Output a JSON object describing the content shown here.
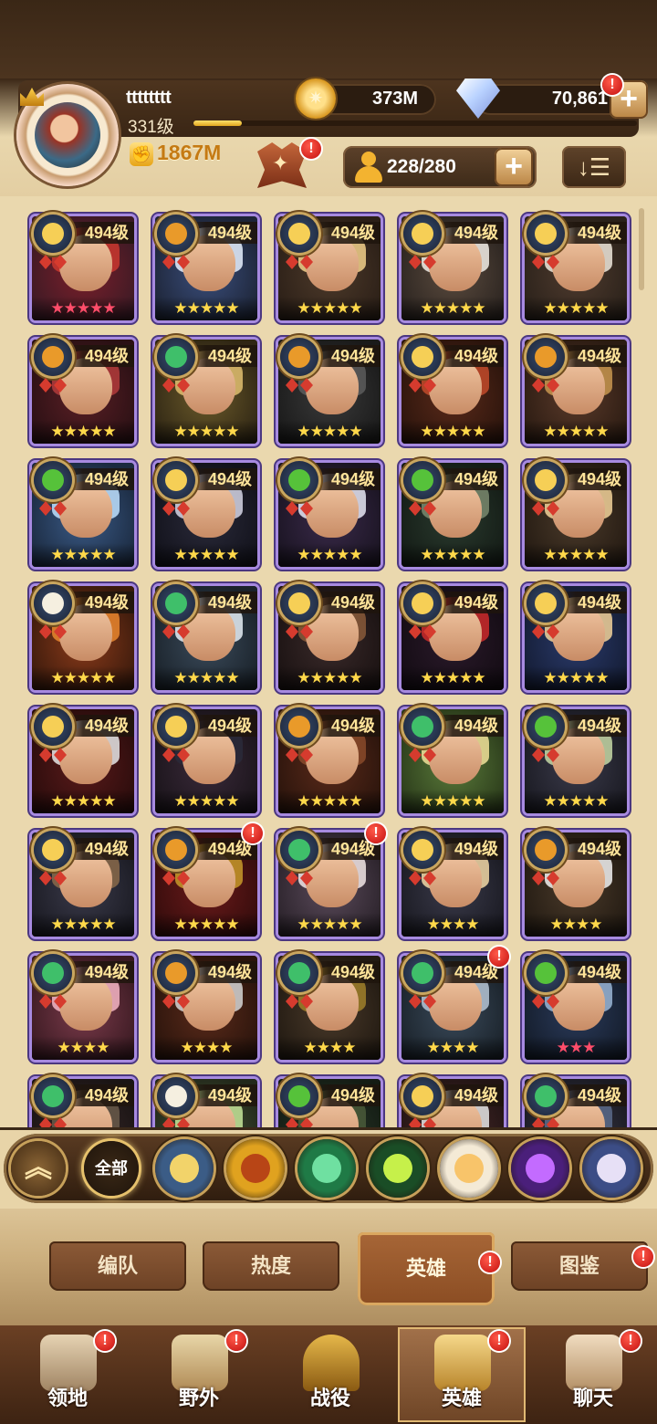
{
  "header": {
    "username": "tttttttt",
    "level": "331级",
    "xp_fraction": 0.11,
    "power": "1867M",
    "power_icon": "fist-icon",
    "gold": "373M",
    "gems": "70,861",
    "hero_slots": "228/280",
    "sort_glyph": "↓☰",
    "plus_glyph": "+",
    "alert_glyph": "!"
  },
  "heroes": [
    {
      "level": "494级",
      "stars": "★★★★★",
      "star_color": "#ff4d6a",
      "faction": "lightbearer",
      "alert": false
    },
    {
      "level": "494级",
      "stars": "★★★★★",
      "star_color": "#ffd84a",
      "faction": "mauler",
      "alert": false
    },
    {
      "level": "494级",
      "stars": "★★★★★",
      "star_color": "#ffd84a",
      "faction": "lightbearer",
      "alert": false
    },
    {
      "level": "494级",
      "stars": "★★★★★",
      "star_color": "#ffd84a",
      "faction": "lightbearer",
      "alert": false
    },
    {
      "level": "494级",
      "stars": "★★★★★",
      "star_color": "#ffd84a",
      "faction": "lightbearer",
      "alert": false
    },
    {
      "level": "494级",
      "stars": "★★★★★",
      "star_color": "#ffd84a",
      "faction": "mauler",
      "alert": false
    },
    {
      "level": "494级",
      "stars": "★★★★★",
      "star_color": "#ffd84a",
      "faction": "wilder",
      "alert": false
    },
    {
      "level": "494级",
      "stars": "★★★★★",
      "star_color": "#ffd84a",
      "faction": "mauler",
      "alert": false
    },
    {
      "level": "494级",
      "stars": "★★★★★",
      "star_color": "#ffd84a",
      "faction": "lightbearer",
      "alert": false
    },
    {
      "level": "494级",
      "stars": "★★★★★",
      "star_color": "#ffd84a",
      "faction": "mauler",
      "alert": false
    },
    {
      "level": "494级",
      "stars": "★★★★★",
      "star_color": "#ffd84a",
      "faction": "graveborn",
      "alert": false
    },
    {
      "level": "494级",
      "stars": "★★★★★",
      "star_color": "#ffd84a",
      "faction": "lightbearer",
      "alert": false
    },
    {
      "level": "494级",
      "stars": "★★★★★",
      "star_color": "#ffd84a",
      "faction": "graveborn",
      "alert": false
    },
    {
      "level": "494级",
      "stars": "★★★★★",
      "star_color": "#ffd84a",
      "faction": "graveborn",
      "alert": false
    },
    {
      "level": "494级",
      "stars": "★★★★★",
      "star_color": "#ffd84a",
      "faction": "lightbearer",
      "alert": false
    },
    {
      "level": "494级",
      "stars": "★★★★★",
      "star_color": "#ffd84a",
      "faction": "celestial",
      "alert": false
    },
    {
      "level": "494级",
      "stars": "★★★★★",
      "star_color": "#ffd84a",
      "faction": "wilder",
      "alert": false
    },
    {
      "level": "494级",
      "stars": "★★★★★",
      "star_color": "#ffd84a",
      "faction": "lightbearer",
      "alert": false
    },
    {
      "level": "494级",
      "stars": "★★★★★",
      "star_color": "#ffd84a",
      "faction": "lightbearer",
      "alert": false
    },
    {
      "level": "494级",
      "stars": "★★★★★",
      "star_color": "#ffd84a",
      "faction": "lightbearer",
      "alert": false
    },
    {
      "level": "494级",
      "stars": "★★★★★",
      "star_color": "#ffd84a",
      "faction": "lightbearer",
      "alert": false
    },
    {
      "level": "494级",
      "stars": "★★★★★",
      "star_color": "#ffd84a",
      "faction": "lightbearer",
      "alert": false
    },
    {
      "level": "494级",
      "stars": "★★★★★",
      "star_color": "#ffd84a",
      "faction": "mauler",
      "alert": false
    },
    {
      "level": "494级",
      "stars": "★★★★★",
      "star_color": "#ffd84a",
      "faction": "wilder",
      "alert": false
    },
    {
      "level": "494级",
      "stars": "★★★★★",
      "star_color": "#ffd84a",
      "faction": "graveborn",
      "alert": false
    },
    {
      "level": "494级",
      "stars": "★★★★★",
      "star_color": "#ffd84a",
      "faction": "lightbearer",
      "alert": false
    },
    {
      "level": "494级",
      "stars": "★★★★★",
      "star_color": "#ffd84a",
      "faction": "mauler",
      "alert": true
    },
    {
      "level": "494级",
      "stars": "★★★★★",
      "star_color": "#ffd84a",
      "faction": "wilder",
      "alert": true
    },
    {
      "level": "494级",
      "stars": "★★★★",
      "star_color": "#ffd84a",
      "faction": "lightbearer",
      "alert": false
    },
    {
      "level": "494级",
      "stars": "★★★★",
      "star_color": "#ffd84a",
      "faction": "mauler",
      "alert": false
    },
    {
      "level": "494级",
      "stars": "★★★★",
      "star_color": "#ffd84a",
      "faction": "wilder",
      "alert": false
    },
    {
      "level": "494级",
      "stars": "★★★★",
      "star_color": "#ffd84a",
      "faction": "mauler",
      "alert": false
    },
    {
      "level": "494级",
      "stars": "★★★★",
      "star_color": "#ffd84a",
      "faction": "wilder",
      "alert": false
    },
    {
      "level": "494级",
      "stars": "★★★★",
      "star_color": "#ffd84a",
      "faction": "wilder",
      "alert": true
    },
    {
      "level": "494级",
      "stars": "★★★",
      "star_color": "#ff4d6a",
      "faction": "graveborn",
      "alert": false
    },
    {
      "level": "494级",
      "stars": "",
      "star_color": "#ffd84a",
      "faction": "wilder",
      "alert": false
    },
    {
      "level": "494级",
      "stars": "",
      "star_color": "#ffd84a",
      "faction": "celestial",
      "alert": false
    },
    {
      "level": "494级",
      "stars": "",
      "star_color": "#ffd84a",
      "faction": "graveborn",
      "alert": false
    },
    {
      "level": "494级",
      "stars": "",
      "star_color": "#ffd84a",
      "faction": "lightbearer",
      "alert": false
    },
    {
      "level": "494级",
      "stars": "",
      "star_color": "#ffd84a",
      "faction": "wilder",
      "alert": false
    }
  ],
  "faction_colors": {
    "lightbearer": "#f6cf56",
    "mauler": "#e99a2a",
    "wilder": "#3fbf6a",
    "graveborn": "#56c23a",
    "celestial": "#f5efe0",
    "hypogean": "#8a4ad6",
    "dimensional": "#7d8bd6"
  },
  "filters": {
    "collapse_glyph": "︽",
    "all_label": "全部",
    "items": [
      {
        "name": "lightbearer",
        "icon": "lightbearer-icon",
        "color": "#3b5c86",
        "inner": "#f2d36a"
      },
      {
        "name": "mauler",
        "icon": "mauler-icon",
        "color": "#e0a21f",
        "inner": "#b84516"
      },
      {
        "name": "wilder",
        "icon": "wilder-icon",
        "color": "#1f7a46",
        "inner": "#6fe0a1"
      },
      {
        "name": "graveborn",
        "icon": "graveborn-icon",
        "color": "#1a4d26",
        "inner": "#c6f04a"
      },
      {
        "name": "celestial",
        "icon": "celestial-icon",
        "color": "#f4ead6",
        "inner": "#f8c46a"
      },
      {
        "name": "hypogean",
        "icon": "hypogean-icon",
        "color": "#4a1f7a",
        "inner": "#c36bff"
      },
      {
        "name": "dimensional",
        "icon": "dimensional-icon",
        "color": "#3c4d86",
        "inner": "#e7e0f6"
      }
    ]
  },
  "subtabs": [
    {
      "label": "编队",
      "active": false,
      "alert": false
    },
    {
      "label": "热度",
      "active": false,
      "alert": false
    },
    {
      "label": "英雄",
      "active": true,
      "alert": true
    },
    {
      "label": "图鉴",
      "active": false,
      "alert": true
    }
  ],
  "bottom_nav": [
    {
      "label": "领地",
      "icon": "castle-icon",
      "active": false,
      "alert": true
    },
    {
      "label": "野外",
      "icon": "map-scroll-icon",
      "active": false,
      "alert": true
    },
    {
      "label": "战役",
      "icon": "swords-icon",
      "active": false,
      "alert": false
    },
    {
      "label": "英雄",
      "icon": "hero-helmet-icon",
      "active": true,
      "alert": true
    },
    {
      "label": "聊天",
      "icon": "chat-bubble-icon",
      "active": false,
      "alert": true
    }
  ]
}
